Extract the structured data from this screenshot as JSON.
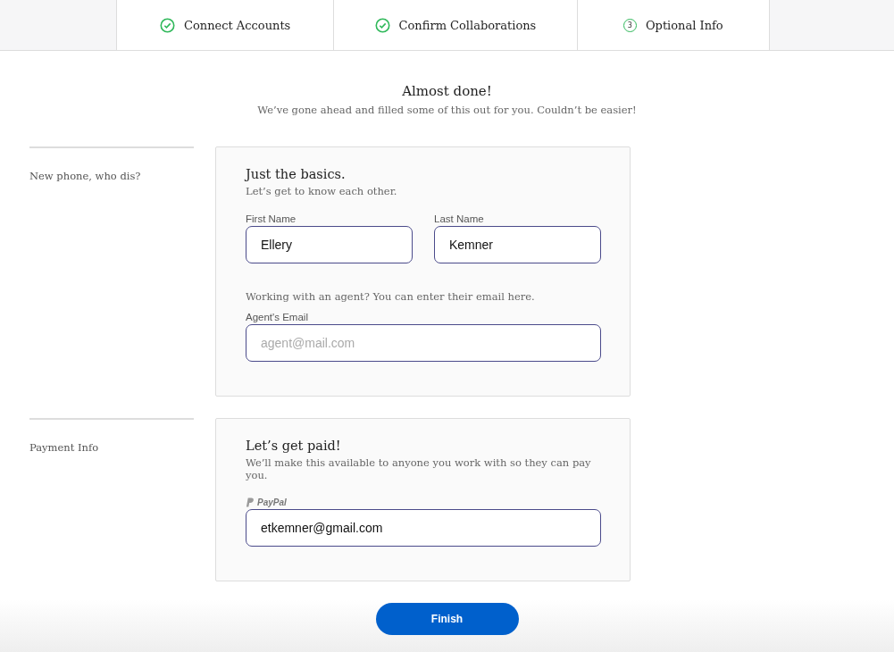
{
  "steps": [
    {
      "label": "Connect Accounts",
      "done": true
    },
    {
      "label": "Confirm Collaborations",
      "done": true
    },
    {
      "label": "Optional Info",
      "done": false,
      "number": "3"
    }
  ],
  "heading": {
    "title": "Almost done!",
    "subtitle": "We’ve gone ahead and filled some of this out for you. Couldn’t be easier!"
  },
  "sections": [
    {
      "side_label": "New phone, who dis?",
      "title": "Just the basics.",
      "subtitle": "Let’s get to know each other.",
      "name_fields": [
        {
          "label": "First Name",
          "value": "Ellery"
        },
        {
          "label": "Last Name",
          "value": "Kemner"
        }
      ],
      "note": "Working with an agent? You can enter their email here.",
      "email_field": {
        "label": "Agent's Email",
        "placeholder": "agent@mail.com"
      }
    },
    {
      "side_label": "Payment Info",
      "title": "Let’s get paid!",
      "subtitle": "We’ll make this available to anyone you work with so they can pay you.",
      "paypal_field": {
        "label": "PayPal",
        "value": "etkemner@gmail.com"
      }
    }
  ],
  "finish_button": "Finish"
}
